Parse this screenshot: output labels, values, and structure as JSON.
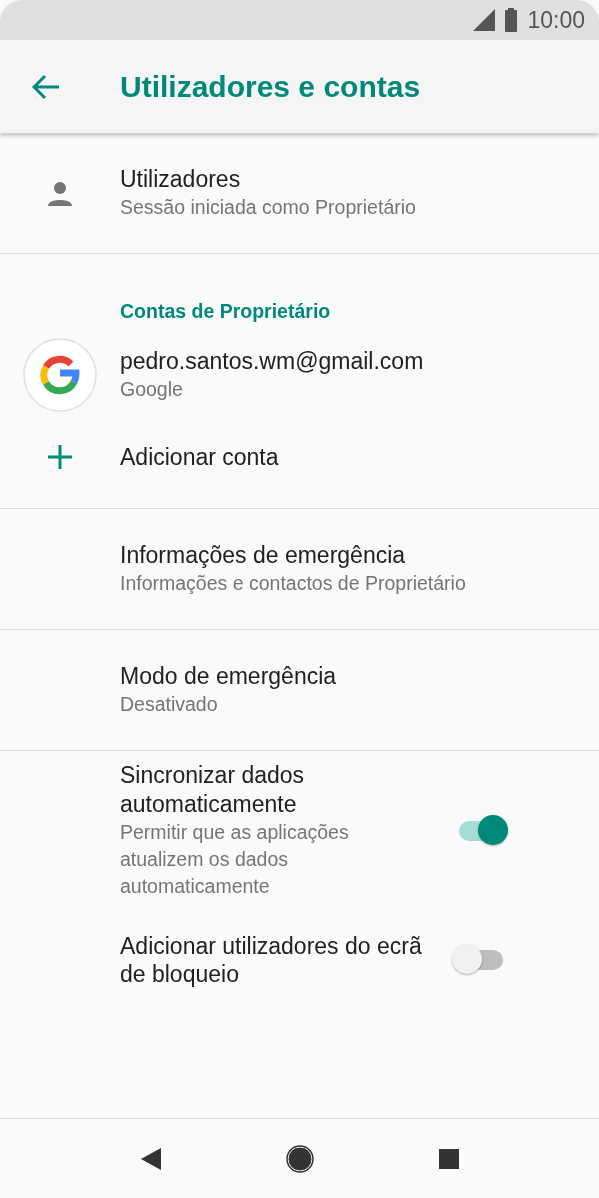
{
  "status_bar": {
    "time": "10:00"
  },
  "app_bar": {
    "title": "Utilizadores e contas"
  },
  "groups": [
    {
      "items": [
        {
          "kind": "user",
          "title": "Utilizadores",
          "subtitle": "Sessão iniciada como Proprietário"
        }
      ]
    },
    {
      "items": [
        {
          "kind": "header",
          "title": "Contas de Proprietário"
        },
        {
          "kind": "account",
          "title": "pedro.santos.wm@gmail.com",
          "subtitle": "Google"
        },
        {
          "kind": "add",
          "title": "Adicionar conta"
        }
      ]
    },
    {
      "items": [
        {
          "kind": "plain",
          "title": "Informações de emergência",
          "subtitle": "Informações e contactos de Proprietário"
        }
      ]
    },
    {
      "items": [
        {
          "kind": "plain",
          "title": "Modo de emergência",
          "subtitle": "Desativado"
        }
      ]
    },
    {
      "items": [
        {
          "kind": "toggle",
          "title": "Sincronizar dados automaticamente",
          "subtitle": "Permitir que as aplicações atualizem os dados automaticamente",
          "on": true
        },
        {
          "kind": "toggle",
          "title": "Adicionar utilizadores do ecrã de bloqueio",
          "on": false
        }
      ]
    }
  ]
}
